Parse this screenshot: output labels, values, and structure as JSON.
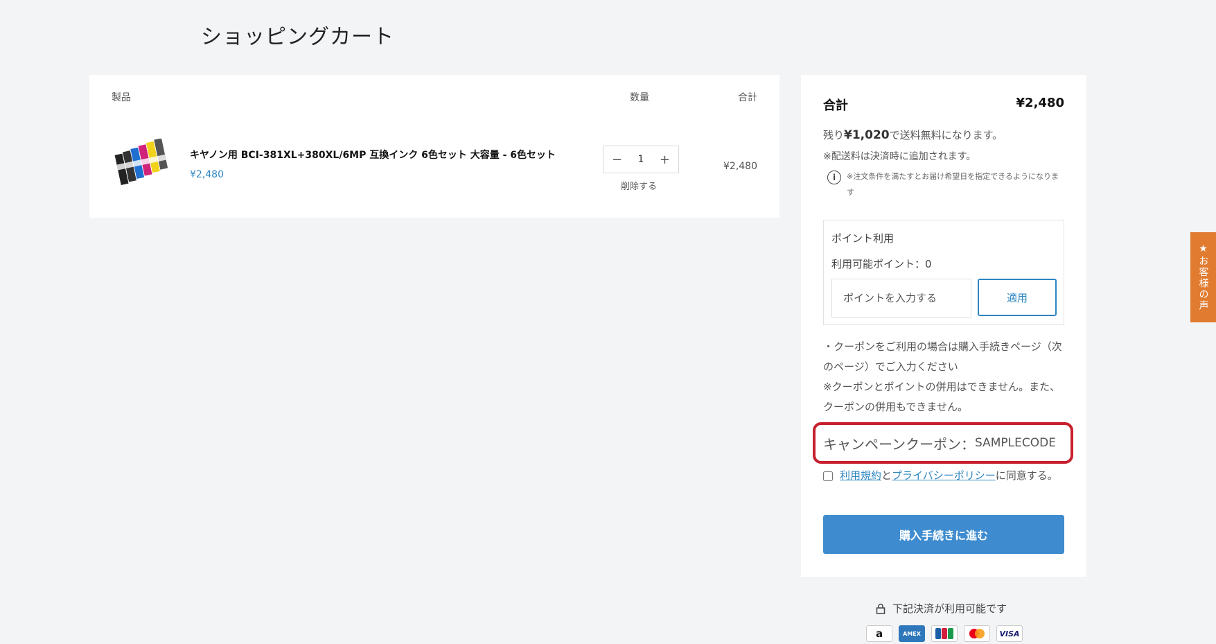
{
  "page": {
    "title": "ショッピングカート"
  },
  "cart": {
    "headers": {
      "product": "製品",
      "quantity": "数量",
      "total": "合計"
    },
    "item": {
      "name": "キヤノン用 BCI-381XL+380XL/6MP 互換インク 6色セット 大容量 - 6色セット",
      "price": "¥2,480",
      "quantity": "1",
      "decrement_symbol": "−",
      "increment_symbol": "+",
      "remove_label": "削除する",
      "line_total": "¥2,480"
    }
  },
  "summary": {
    "total_label": "合計",
    "total_value": "¥2,480",
    "free_shipping_prefix": "残り",
    "free_shipping_amount": "¥1,020",
    "free_shipping_suffix": "で送料無料になります。",
    "shipping_note": "※配送料は決済時に追加されます。",
    "info_icon_glyph": "i",
    "info_text": "※注文条件を満たすとお届け希望日を指定できるようになります",
    "points": {
      "title": "ポイント利用",
      "available": "利用可能ポイント：0",
      "input_placeholder": "ポイントを入力する",
      "apply_label": "適用"
    },
    "coupon_notes": [
      "・クーポンをご利用の場合は購入手続きページ（次のページ）でご入力ください",
      "※クーポンとポイントの併用はできません。また、クーポンの併用もできません。"
    ],
    "campaign_label": "キャンペーンクーポン：",
    "campaign_code": "SAMPLECODE",
    "agreement": {
      "terms_link": "利用規約",
      "joiner": "と",
      "privacy_link": "プライバシーポリシー",
      "suffix": "に同意する。"
    },
    "checkout_label": "購入手続きに進む"
  },
  "payment": {
    "note": "下記決済が利用可能です",
    "cards": [
      "amazon-pay",
      "amex",
      "jcb",
      "mastercard",
      "visa"
    ],
    "card_labels": {
      "amazon": "a",
      "amex": "AMEX",
      "visa": "VISA"
    }
  },
  "review_tab": {
    "label": "★お客様の声"
  },
  "colors": {
    "accent": "#2e86c1",
    "checkout_button": "#3e8ccf",
    "highlight_border": "#c8202f",
    "review_tab": "#e07b30"
  }
}
